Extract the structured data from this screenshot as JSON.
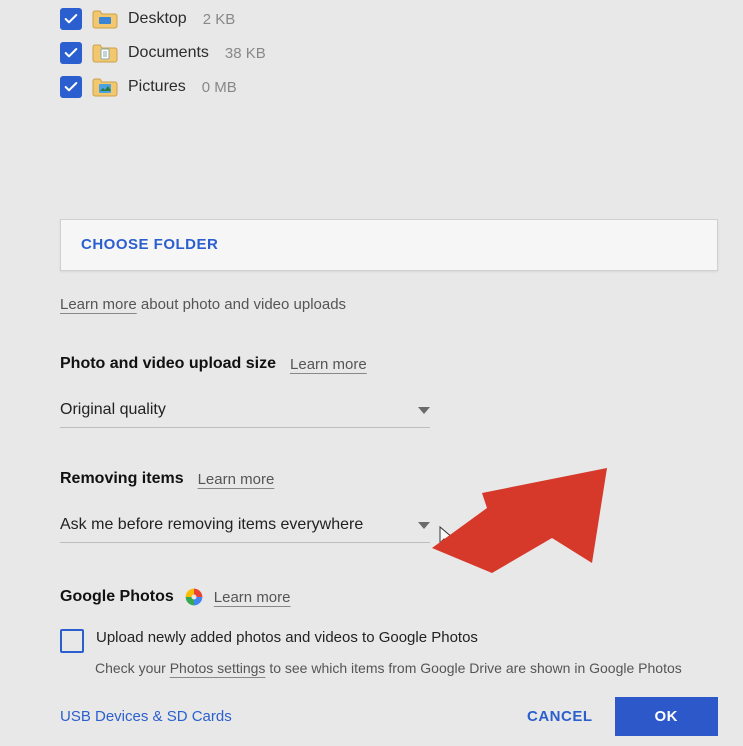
{
  "folders": [
    {
      "name": "Desktop",
      "size": "2 KB",
      "icon": "desktop"
    },
    {
      "name": "Documents",
      "size": "38 KB",
      "icon": "documents"
    },
    {
      "name": "Pictures",
      "size": "0 MB",
      "icon": "pictures"
    }
  ],
  "choose_folder": "CHOOSE FOLDER",
  "upload_desc_link": "Learn more",
  "upload_desc_rest": " about photo and video uploads",
  "upload_size": {
    "title": "Photo and video upload size",
    "learn": "Learn more",
    "value": "Original quality"
  },
  "removing": {
    "title": "Removing items",
    "learn": "Learn more",
    "value": "Ask me before removing items everywhere"
  },
  "gphotos": {
    "title": "Google Photos",
    "learn": "Learn more",
    "checkbox_label": "Upload newly added photos and videos to Google Photos",
    "sub_pre": "Check your ",
    "sub_link": "Photos settings",
    "sub_post": " to see which items from Google Drive are shown in Google Photos"
  },
  "footer": {
    "usb": "USB Devices & SD Cards",
    "cancel": "CANCEL",
    "ok": "OK"
  }
}
